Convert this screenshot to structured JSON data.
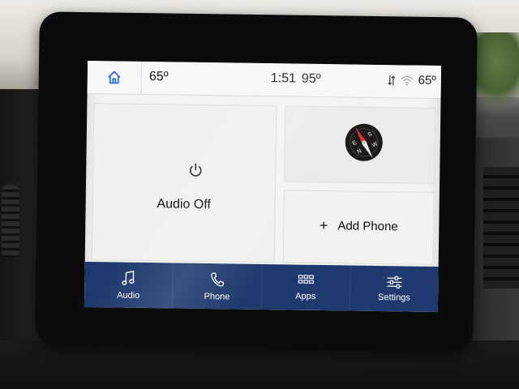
{
  "status_bar": {
    "cabin_temp": "65º",
    "time": "1:51",
    "outside_temp": "95º",
    "right_temp": "65º"
  },
  "tiles": {
    "audio_label": "Audio Off",
    "compass_letters": [
      "E",
      "S",
      "N",
      "W"
    ],
    "add_phone_plus": "+",
    "add_phone_label": "Add Phone"
  },
  "nav": {
    "items": [
      {
        "label": "Audio",
        "icon": "music-note-icon"
      },
      {
        "label": "Phone",
        "icon": "phone-icon"
      },
      {
        "label": "Apps",
        "icon": "apps-grid-icon"
      },
      {
        "label": "Settings",
        "icon": "settings-sliders-icon"
      }
    ]
  },
  "colors": {
    "nav_background": "#1f3a6e",
    "home_icon": "#2f6fd6",
    "screen_background": "#f3f3f1"
  }
}
